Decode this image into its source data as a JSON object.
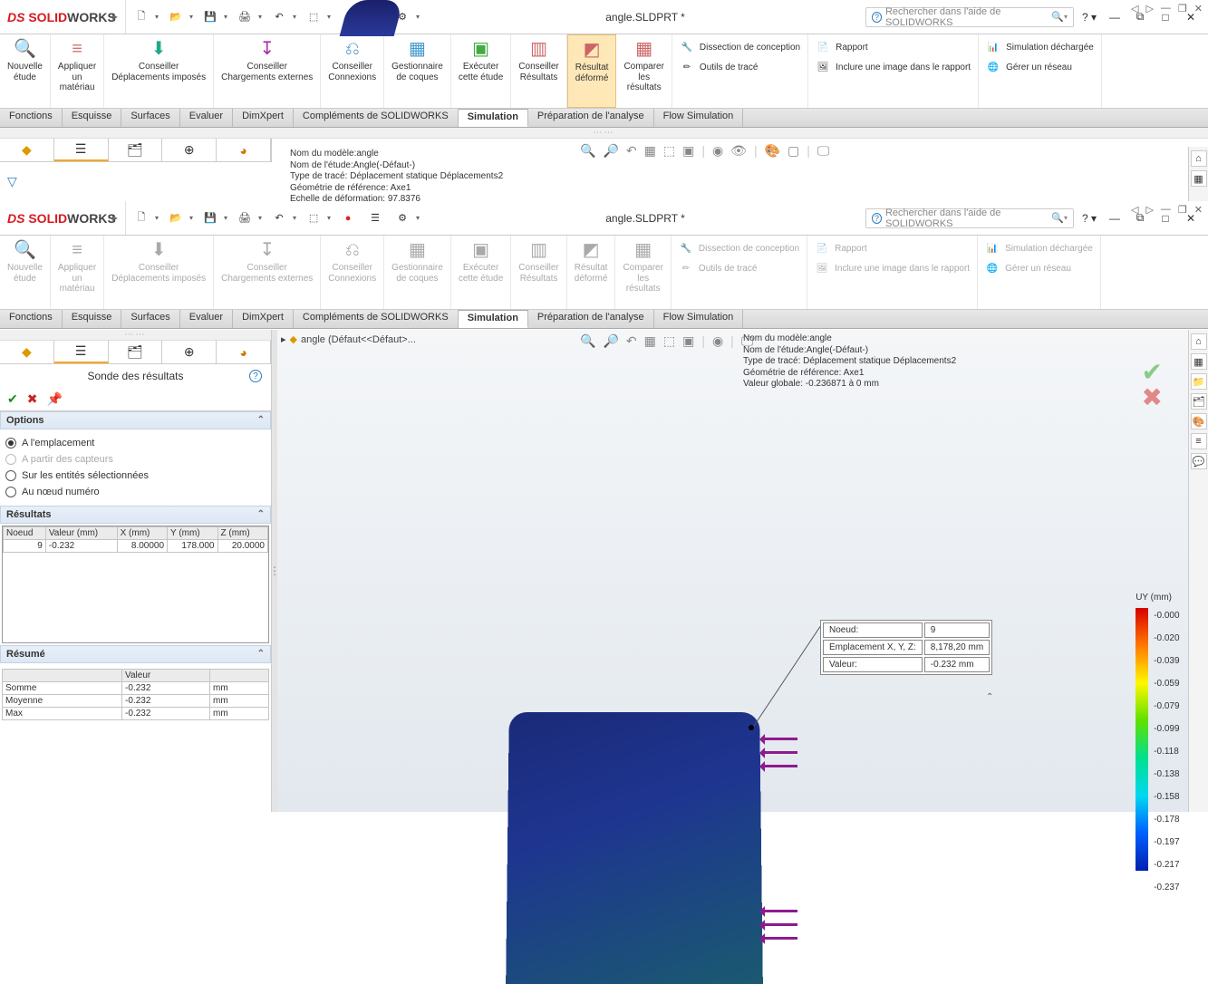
{
  "title": "angle.SLDPRT *",
  "search_placeholder": "Rechercher dans l'aide de SOLIDWORKS",
  "tabs": [
    "Fonctions",
    "Esquisse",
    "Surfaces",
    "Evaluer",
    "DimXpert",
    "Compléments de SOLIDWORKS",
    "Simulation",
    "Préparation de l'analyse",
    "Flow Simulation"
  ],
  "active_tab": "Simulation",
  "ribbon": {
    "nouvelle": "Nouvelle\nétude",
    "appliquer": "Appliquer\nun\nmatériau",
    "c1": "Conseiller\nDéplacements imposés",
    "c2": "Conseiller\nChargements externes",
    "c3": "Conseiller\nConnexions",
    "gest": "Gestionnaire\nde coques",
    "exec": "Exécuter\ncette étude",
    "cres": "Conseiller\nRésultats",
    "rdef": "Résultat\ndéformé",
    "comp": "Comparer\nles\nrésultats",
    "diss": "Dissection de conception",
    "otrace": "Outils de tracé",
    "rapport": "Rapport",
    "inclure": "Inclure une image dans le rapport",
    "simde": "Simulation déchargée",
    "gerer": "Gérer un réseau"
  },
  "info1": {
    "l1": "Nom du modèle:angle",
    "l2": "Nom de l'étude:Angle(-Défaut-)",
    "l3": "Type de tracé: Déplacement statique Déplacements2",
    "l4": "Géométrie de référence: Axe1",
    "l5": "Echelle de déformation: 97.8376"
  },
  "info2": {
    "l1": "Nom du modèle:angle",
    "l2": "Nom de l'étude:Angle(-Défaut-)",
    "l3": "Type de tracé: Déplacement statique Déplacements2",
    "l4": "Géométrie de référence: Axe1",
    "l5": "Valeur globale: -0.236871 à 0 mm"
  },
  "breadcrumb": "angle  (Défaut<<Défaut>...",
  "panel": {
    "title": "Sonde des résultats",
    "options_hdr": "Options",
    "opt1": "A l'emplacement",
    "opt2": "A partir des capteurs",
    "opt3": "Sur les entités sélectionnées",
    "opt4": "Au nœud numéro",
    "results_hdr": "Résultats",
    "cols": [
      "Noeud",
      "Valeur (mm)",
      "X (mm)",
      "Y (mm)",
      "Z (mm)"
    ],
    "row": [
      "9",
      "-0.232",
      "8.00000",
      "178.000",
      "20.0000"
    ],
    "resume_hdr": "Résumé",
    "resume_col": "Valeur",
    "resume_rows": [
      [
        "Somme",
        "-0.232",
        "mm"
      ],
      [
        "Moyenne",
        "-0.232",
        "mm"
      ],
      [
        "Max",
        "-0.232",
        "mm"
      ]
    ]
  },
  "callout": {
    "r1k": "Noeud:",
    "r1v": "9",
    "r2k": "Emplacement X, Y, Z:",
    "r2v": "8,178,20 mm",
    "r3k": "Valeur:",
    "r3v": "-0.232     mm"
  },
  "legend": {
    "title": "UY (mm)",
    "vals": [
      "-0.000",
      "-0.020",
      "-0.039",
      "-0.059",
      "-0.079",
      "-0.099",
      "-0.118",
      "-0.138",
      "-0.158",
      "-0.178",
      "-0.197",
      "-0.217",
      "-0.237"
    ]
  }
}
